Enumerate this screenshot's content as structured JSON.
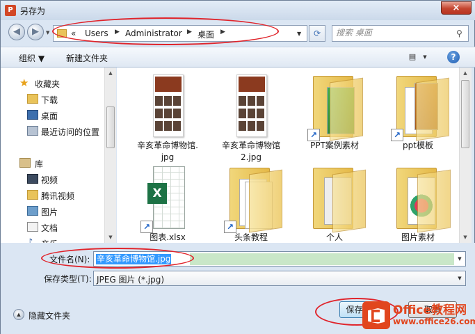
{
  "window": {
    "title": "另存为",
    "close_glyph": "×",
    "app_icon_letter": "P"
  },
  "address_bar": {
    "crumbs": [
      "Users",
      "Administrator",
      "桌面"
    ],
    "prefix_glyph": "«",
    "separator_glyph": "▶"
  },
  "search": {
    "placeholder": "搜索 桌面"
  },
  "toolbar": {
    "organize_label": "组织 ▼",
    "new_folder_label": "新建文件夹",
    "help_glyph": "?"
  },
  "nav_pane": {
    "items": [
      {
        "label": "收藏夹",
        "icon": "star-icon",
        "group": true
      },
      {
        "label": "下载",
        "icon": "download-folder-icon"
      },
      {
        "label": "桌面",
        "icon": "desktop-icon"
      },
      {
        "label": "最近访问的位置",
        "icon": "recent-places-icon"
      },
      {
        "label": "库",
        "icon": "library-icon",
        "group": true
      },
      {
        "label": "视频",
        "icon": "videos-icon"
      },
      {
        "label": "腾讯视频",
        "icon": "folder-icon"
      },
      {
        "label": "图片",
        "icon": "pictures-icon"
      },
      {
        "label": "文档",
        "icon": "documents-icon"
      },
      {
        "label": "音乐",
        "icon": "music-icon"
      }
    ]
  },
  "files": [
    {
      "name": "辛亥革命博物馆.jpg",
      "line1": "辛亥革命博物馆.",
      "line2": "jpg",
      "kind": "image"
    },
    {
      "name": "辛亥革命博物馆2.jpg",
      "line1": "辛亥革命博物馆",
      "line2": "2.jpg",
      "kind": "image"
    },
    {
      "name": "PPT案例素材",
      "line1": "PPT案例素材",
      "line2": "",
      "kind": "folder-shortcut"
    },
    {
      "name": "ppt模板",
      "line1": "ppt模板",
      "line2": "",
      "kind": "folder-shortcut"
    },
    {
      "name": "图表.xlsx",
      "line1": "图表.xlsx",
      "line2": "",
      "kind": "excel-shortcut"
    },
    {
      "name": "头条教程",
      "line1": "头条教程",
      "line2": "",
      "kind": "folder-shortcut"
    },
    {
      "name": "个人",
      "line1": "个人",
      "line2": "",
      "kind": "folder"
    },
    {
      "name": "图片素材",
      "line1": "图片素材",
      "line2": "",
      "kind": "folder"
    }
  ],
  "form": {
    "filename_label": "文件名(N):",
    "filename_value": "辛亥革命博物馆.jpg",
    "filetype_label": "保存类型(T):",
    "filetype_value": "JPEG 图片 (*.jpg)"
  },
  "footer": {
    "hide_folders_label": "隐藏文件夹",
    "save_label": "保存(S)",
    "cancel_label": "取消"
  },
  "watermark": {
    "brand": "Office教程网",
    "url": "www.office26.com"
  },
  "colors": {
    "annotation": "#e0242b",
    "selection": "#3399ff",
    "excel": "#1d7245",
    "watermark": "#e1461e"
  }
}
